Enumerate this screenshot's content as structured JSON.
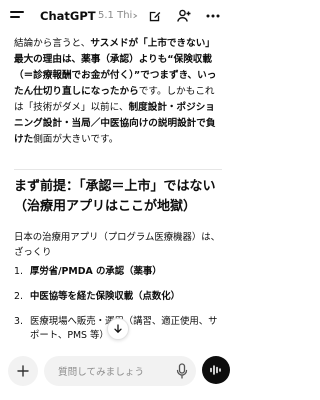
{
  "header": {
    "app_title": "ChatGPT",
    "model_label": "5.1 Thi...",
    "menu_icon": "menu-icon",
    "edit_icon": "new-chat-icon",
    "user_icon": "add-user-icon",
    "more_icon": "more-icon"
  },
  "message": {
    "para1_a": "結論から言うと、",
    "para1_b": "サスメドが「上市できない」最大の理由は、薬事（承認）よりも“保険収載（＝診療報酬でお金が付く）”でつまずき、いったん仕切り直しになったから",
    "para1_c": "です。しかもこれは「技術がダメ」以前に、",
    "para1_d": "制度設計・ポジショニング設計・当局／中医協向けの説明設計で負けた",
    "para1_e": "側面が大きいです。",
    "heading": "まず前提：「承認＝上市」ではない（治療用アプリはここが地獄）",
    "para2": "日本の治療用アプリ（プログラム医療機器）は、ざっくり",
    "list": [
      {
        "num": "1.",
        "text": "厚労省/PMDA の承認（薬事）",
        "bold": true
      },
      {
        "num": "2.",
        "text": "中医協等を経た保険収載（点数化）",
        "bold": true
      },
      {
        "num": "3.",
        "text": "医療現場へ販売・運用（講習、適正使用、サポート、PMS 等）",
        "bold": false
      }
    ]
  },
  "composer": {
    "placeholder": "質問してみましょう",
    "plus_icon": "plus-icon",
    "mic_icon": "mic-icon",
    "voice_icon": "voice-mode-icon"
  }
}
